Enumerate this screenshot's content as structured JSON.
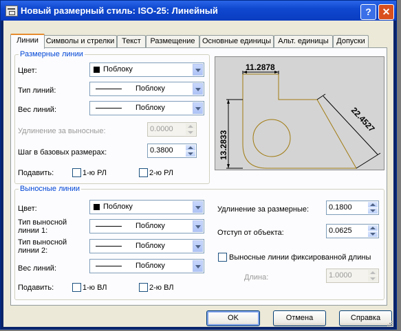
{
  "window": {
    "title": "Новый размерный стиль: ISO-25: Линейный",
    "help_label": "?",
    "close_label": "✕"
  },
  "tabs": [
    "Линии",
    "Символы и стрелки",
    "Текст",
    "Размещение",
    "Основные единицы",
    "Альт. единицы",
    "Допуски"
  ],
  "dim_lines": {
    "title": "Размерные линии",
    "color_label": "Цвет:",
    "color_value": "Поблоку",
    "linetype_label": "Тип линий:",
    "linetype_value": "Поблоку",
    "lineweight_label": "Вес линий:",
    "lineweight_value": "Поблоку",
    "extend_label": "Удлинение за выносные:",
    "extend_value": "0.0000",
    "baseline_label": "Шаг в базовых размерах:",
    "baseline_value": "0.3800",
    "suppress_label": "Подавить:",
    "suppress1": "1-ю РЛ",
    "suppress2": "2-ю РЛ"
  },
  "ext_lines": {
    "title": "Выносные линии",
    "color_label": "Цвет:",
    "color_value": "Поблоку",
    "lt1_label_a": "Тип выносной",
    "lt1_label_b": "линии 1:",
    "lt1_value": "Поблоку",
    "lt2_label_a": "Тип выносной",
    "lt2_label_b": "линии 2:",
    "lt2_value": "Поблоку",
    "lineweight_label": "Вес линий:",
    "lineweight_value": "Поблоку",
    "suppress_label": "Подавить:",
    "suppress1": "1-ю ВЛ",
    "suppress2": "2-ю ВЛ",
    "extend_label": "Удлинение за размерные:",
    "extend_value": "0.1800",
    "offset_label": "Отступ от объекта:",
    "offset_value": "0.0625",
    "fixed_label": "Выносные линии фиксированной длины",
    "length_label": "Длина:",
    "length_value": "1.0000"
  },
  "preview": {
    "dim_top": "11.2878",
    "dim_left": "13.2833",
    "dim_angled": "22.4527"
  },
  "buttons": {
    "ok": "OK",
    "cancel": "Отмена",
    "help": "Справка"
  },
  "colors": {
    "accent_tab": "#e68b2c",
    "title_bar": "#0f48d0",
    "group_label": "#0046d5",
    "preview_outline": "#a07a10"
  }
}
